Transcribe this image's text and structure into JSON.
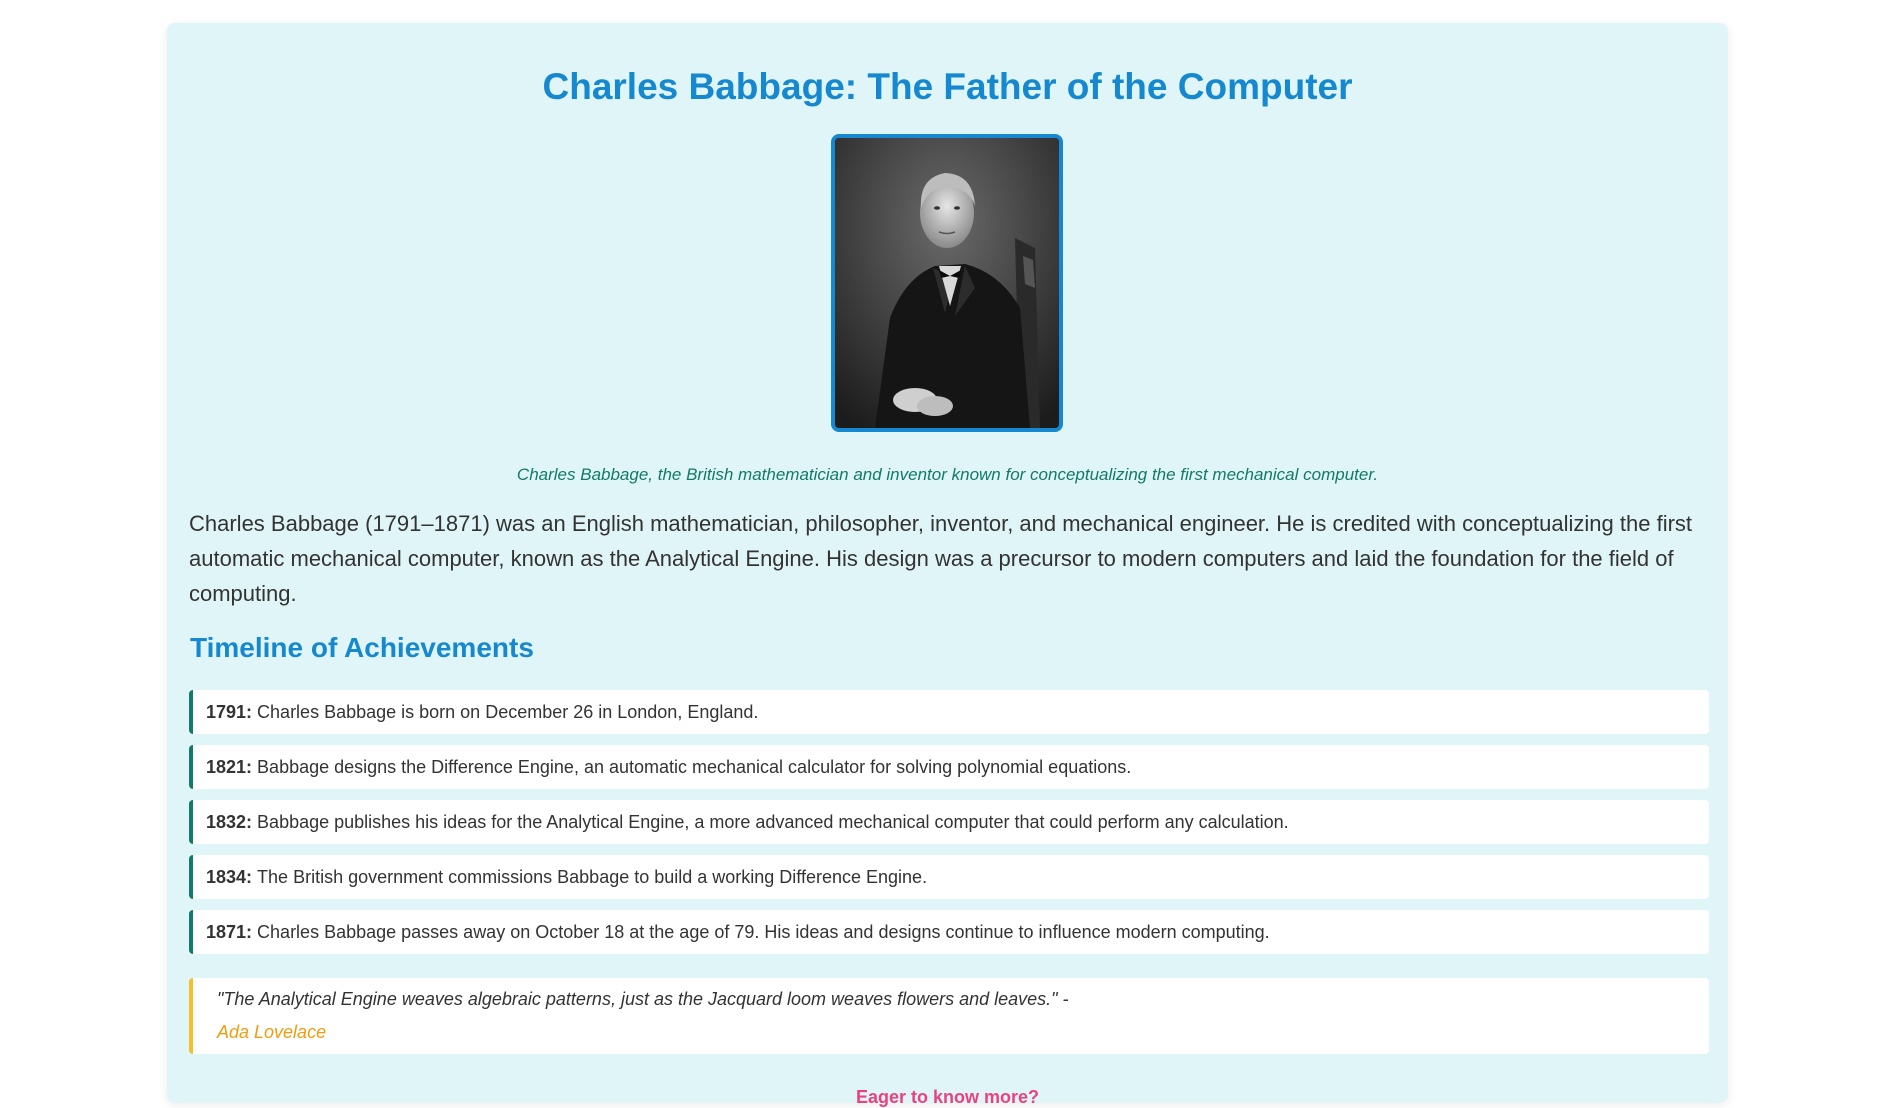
{
  "page": {
    "title": "Charles Babbage: The Father of the Computer"
  },
  "portrait": {
    "icon": "portrait-photo",
    "caption": "Charles Babbage, the British mathematician and inventor known for conceptualizing the first mechanical computer."
  },
  "intro": {
    "text": "Charles Babbage (1791–1871) was an English mathematician, philosopher, inventor, and mechanical engineer. He is credited with conceptualizing the first automatic mechanical computer, known as the Analytical Engine. His design was a precursor to modern computers and laid the foundation for the field of computing."
  },
  "timeline": {
    "heading": "Timeline of Achievements",
    "items": [
      {
        "year": "1791:",
        "text": "Charles Babbage is born on December 26 in London, England."
      },
      {
        "year": "1821:",
        "text": "Babbage designs the Difference Engine, an automatic mechanical calculator for solving polynomial equations."
      },
      {
        "year": "1832:",
        "text": "Babbage publishes his ideas for the Analytical Engine, a more advanced mechanical computer that could perform any calculation."
      },
      {
        "year": "1834:",
        "text": "The British government commissions Babbage to build a working Difference Engine."
      },
      {
        "year": "1871:",
        "text": "Charles Babbage passes away on October 18 at the age of 79. His ideas and designs continue to influence modern computing."
      }
    ]
  },
  "quote": {
    "text": "\"The Analytical Engine weaves algebraic patterns, just as the Jacquard loom weaves flowers and leaves.\" -",
    "author": "Ada Lovelace"
  },
  "cta": {
    "label": "Eager to know more?"
  },
  "colors": {
    "accent": "#1588cf",
    "timeline_border": "#127a68",
    "quote_border": "#f5bf2a",
    "quote_author": "#f29b0e",
    "cta": "#e8437f",
    "card_background": "#e0f5f8"
  }
}
